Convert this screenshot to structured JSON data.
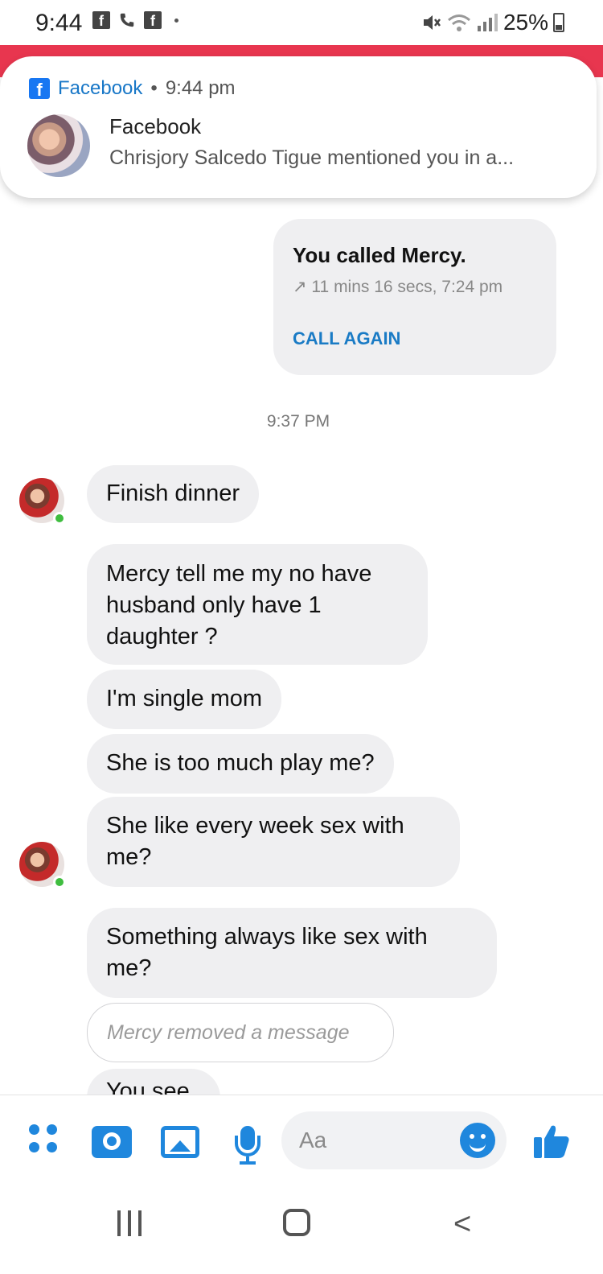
{
  "status_bar": {
    "time": "9:44",
    "battery": "25%"
  },
  "notification": {
    "app_name": "Facebook",
    "time": "9:44 pm",
    "separator": "•",
    "title": "Facebook",
    "text": "Chrisjory Salcedo Tigue mentioned you in a..."
  },
  "call_card": {
    "title": "You called Mercy.",
    "detail": "↗ 11 mins 16 secs, 7:24 pm",
    "action": "CALL AGAIN"
  },
  "timestamp": "9:37 PM",
  "messages": [
    "Finish dinner",
    "Mercy tell me my no have husband only have 1 daughter ?",
    "I'm single mom",
    "She is too much play me?",
    "She like every week sex with me?",
    "Something always like sex with me?"
  ],
  "removed_message": "Mercy removed a message",
  "partial_message": "You see",
  "composer": {
    "placeholder": "Aa"
  },
  "colors": {
    "accent": "#1f87dd",
    "notification_banner": "#e8364f",
    "bubble": "#efeff1",
    "online": "#3fbd3f"
  }
}
